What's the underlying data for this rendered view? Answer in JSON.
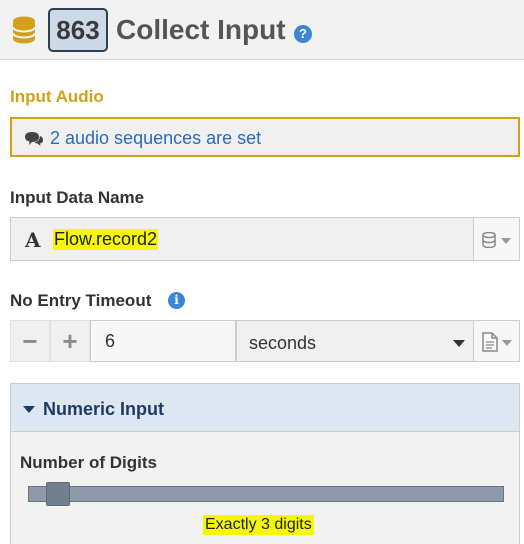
{
  "header": {
    "id_badge": "863",
    "title": "Collect Input",
    "help_icon": "?"
  },
  "input_audio": {
    "label": "Input Audio",
    "summary": "2 audio sequences are set",
    "accent_color": "#d4a017"
  },
  "input_data_name": {
    "label": "Input Data Name",
    "type_icon": "A",
    "value": "Flow.record2"
  },
  "no_entry_timeout": {
    "label": "No Entry Timeout",
    "info_icon": "i",
    "minus_label": "−",
    "plus_label": "+",
    "value": "6",
    "unit": "seconds"
  },
  "numeric_input": {
    "title": "Numeric Input",
    "digits_label": "Number of Digits",
    "digits_value": 3,
    "digits_text": "Exactly 3 digits"
  },
  "colors": {
    "link_blue": "#2a6bc2",
    "panel_title": "#1e3a66",
    "highlight": "#f5f800"
  }
}
